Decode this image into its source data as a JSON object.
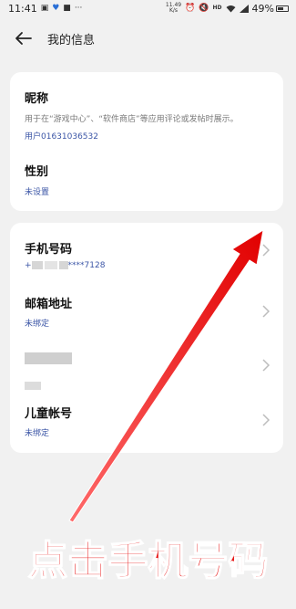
{
  "status_bar": {
    "time": "11:41",
    "left_icons": [
      "gallery-icon",
      "heart-icon",
      "bag-icon",
      "more-icon"
    ],
    "more_text": "···",
    "net_speed_top": "11.49",
    "net_speed_bottom": "K/s",
    "right_icons": [
      "alarm-icon",
      "mute-icon",
      "hd-icon",
      "wifi-icon",
      "signal-icon"
    ],
    "hd_text": "HD",
    "battery": "49%",
    "battery_level": 0.49
  },
  "header": {
    "title": "我的信息"
  },
  "profile_card": {
    "nickname_title": "昵称",
    "nickname_desc": "用于在“游戏中心”、“软件商店”等应用评论或发帖时展示。",
    "nickname_value": "用户01631036532",
    "gender_title": "性别",
    "gender_value": "未设置"
  },
  "account_card": {
    "phone_title": "手机号码",
    "phone_prefix": "+",
    "phone_suffix": "****7128",
    "email_title": "邮箱地址",
    "email_value": "未绑定",
    "child_title": "儿童帐号",
    "child_value": "未绑定"
  },
  "annotation": {
    "caption": "点击手机号码",
    "color": "#e81b1b"
  },
  "colors": {
    "link_blue": "#3b55a6",
    "background": "#f1f1f1"
  }
}
